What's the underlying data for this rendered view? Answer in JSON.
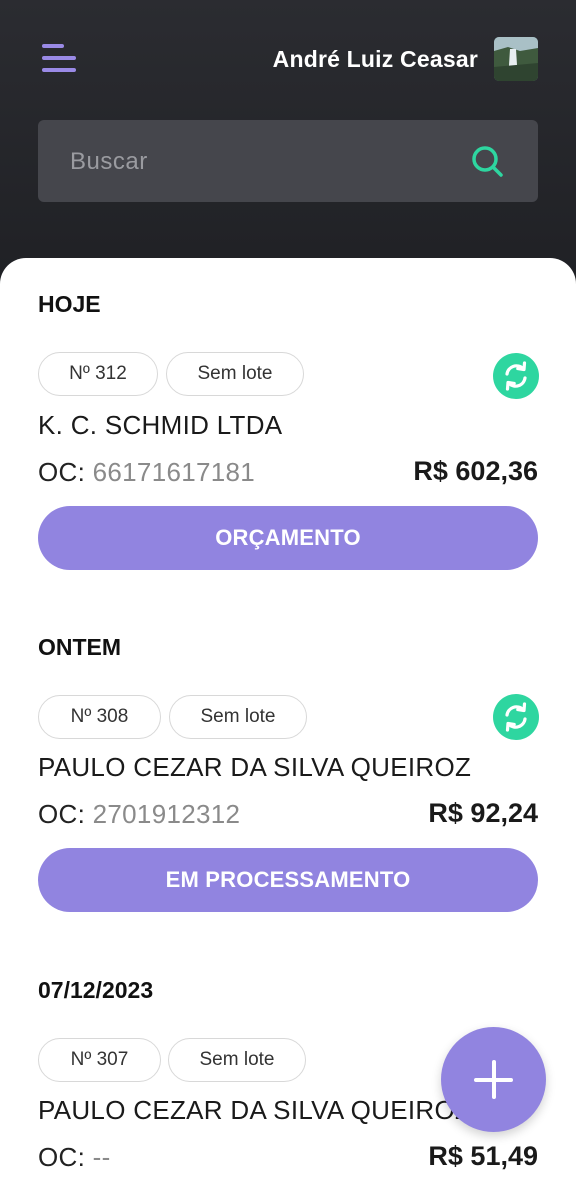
{
  "header": {
    "user_name": "André Luiz Ceasar",
    "search_placeholder": "Buscar"
  },
  "colors": {
    "accent": "#9184e0",
    "sync_green": "#2ed6a0",
    "header_bg": "#1f2024"
  },
  "sections": [
    {
      "title": "HOJE",
      "order": {
        "number": "Nº 312",
        "lot": "Sem lote",
        "client": "K. C. SCHMID LTDA",
        "oc_label": "OC:",
        "oc_value": "66171617181",
        "amount": "R$ 602,36",
        "status": "ORÇAMENTO"
      }
    },
    {
      "title": "ONTEM",
      "order": {
        "number": "Nº 308",
        "lot": "Sem lote",
        "client": "PAULO CEZAR DA SILVA QUEIROZ",
        "oc_label": "OC:",
        "oc_value": "2701912312",
        "amount": "R$ 92,24",
        "status": "EM PROCESSAMENTO"
      }
    },
    {
      "title": "07/12/2023",
      "order": {
        "number": "Nº 307",
        "lot": "Sem lote",
        "client": "PAULO CEZAR DA SILVA QUEIROZ",
        "oc_label": "OC:",
        "oc_value": "--",
        "amount": "R$ 51,49"
      }
    }
  ],
  "icons": {
    "menu": "menu-icon",
    "search": "search-icon",
    "sync": "sync-icon",
    "add": "plus-icon"
  }
}
